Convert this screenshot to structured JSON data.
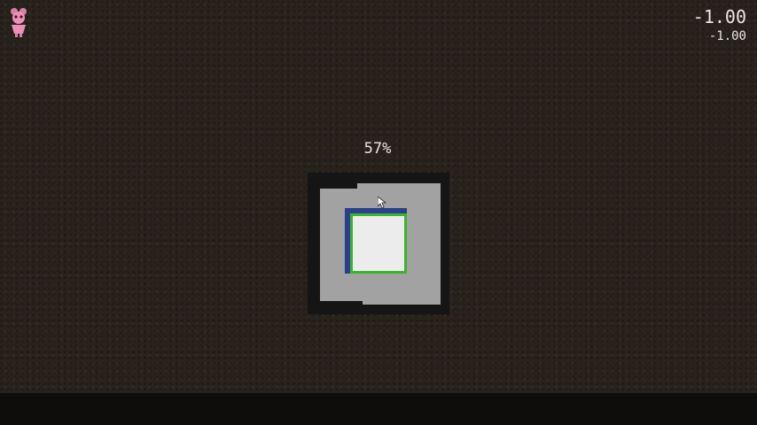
{
  "hud": {
    "coord_main": "-1.00",
    "coord_sub": "-1.00",
    "player_icon": "pink-pig-character-icon"
  },
  "loader": {
    "progress_label": "57%",
    "progress_fraction": 0.57,
    "colors": {
      "frame": "#151515",
      "gray": "#a2a2a2",
      "blue_border": "#2b3f8c",
      "green_border": "#3ab52c",
      "inner_fill": "#ececec"
    }
  },
  "colors": {
    "background": "#2a231d",
    "bottom_bar": "#0e0d0c",
    "text": "#e8e8e8"
  }
}
